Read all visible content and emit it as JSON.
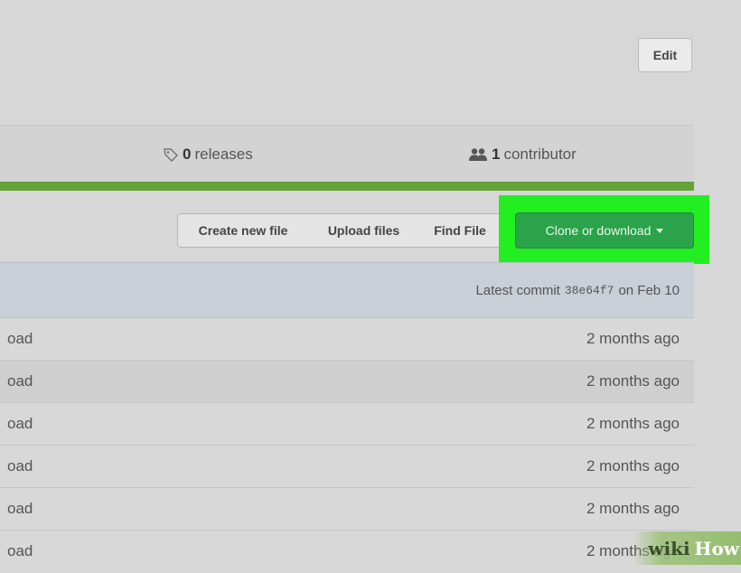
{
  "header": {
    "edit_label": "Edit"
  },
  "stats": {
    "releases_count": "0",
    "releases_label": "releases",
    "contributors_count": "1",
    "contributors_label": "contributor",
    "language_bar_color": "#66a23a"
  },
  "toolbar": {
    "create_new_file": "Create new file",
    "upload_files": "Upload files",
    "find_file": "Find File",
    "clone_or_download": "Clone or download",
    "clone_color": "#2aa34a",
    "highlight_color": "#22ee22"
  },
  "commit": {
    "prefix": "Latest commit",
    "sha": "38e64f7",
    "date": "on Feb 10"
  },
  "files": [
    {
      "name": "oad",
      "age": "2 months ago"
    },
    {
      "name": "oad",
      "age": "2 months ago"
    },
    {
      "name": "oad",
      "age": "2 months ago"
    },
    {
      "name": "oad",
      "age": "2 months ago"
    },
    {
      "name": "oad",
      "age": "2 months ago"
    },
    {
      "name": "oad",
      "age": "2 months ago"
    }
  ],
  "watermark": {
    "wiki": "wiki",
    "how": "How"
  },
  "icons": {
    "releases": "tag-icon",
    "contributors": "people-icon",
    "clone_caret": "caret-down-icon"
  }
}
